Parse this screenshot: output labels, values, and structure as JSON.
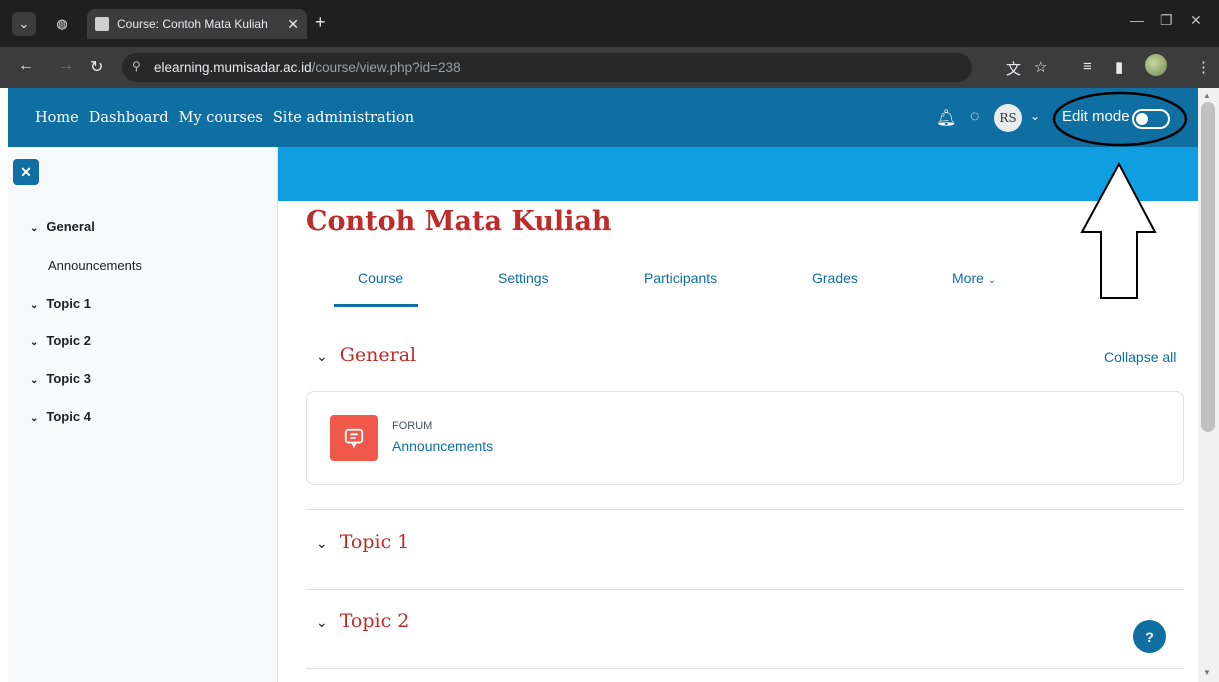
{
  "browser": {
    "tab_title": "Course: Contoh Mata Kuliah",
    "url_host": "elearning.mumisadar.ac.id",
    "url_path": "/course/view.php?id=238"
  },
  "navbar": {
    "links": [
      "Home",
      "Dashboard",
      "My courses",
      "Site administration"
    ],
    "avatar_initials": "RS",
    "edit_mode_label": "Edit mode"
  },
  "sidebar": {
    "items": [
      {
        "label": "General"
      },
      {
        "label": "Announcements"
      },
      {
        "label": "Topic 1"
      },
      {
        "label": "Topic 2"
      },
      {
        "label": "Topic 3"
      },
      {
        "label": "Topic 4"
      }
    ]
  },
  "course": {
    "title": "Contoh Mata Kuliah",
    "tabs": [
      "Course",
      "Settings",
      "Participants",
      "Grades",
      "More"
    ],
    "collapse_all": "Collapse all",
    "sections": [
      "General",
      "Topic 1",
      "Topic 2"
    ],
    "activity": {
      "type": "FORUM",
      "name": "Announcements"
    }
  },
  "help_label": "?"
}
